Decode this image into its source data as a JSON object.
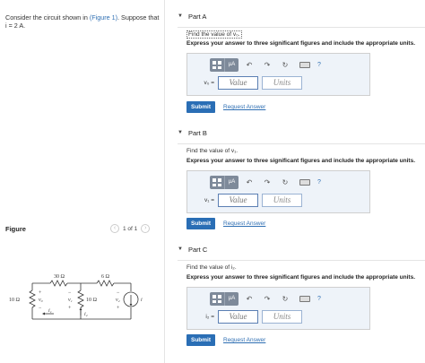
{
  "problem": {
    "text_before": "Consider the circuit shown in ",
    "figure_link": "(Figure 1)",
    "text_after": ". Suppose that i = 2 A."
  },
  "figure": {
    "label": "Figure",
    "pager_text": "1 of 1",
    "prev_icon": "chevron-left",
    "next_icon": "chevron-right",
    "circuit": {
      "r1": "10 Ω",
      "r2": "30 Ω",
      "r3": "10 Ω",
      "r4": "6 Ω",
      "v0": "v₀",
      "v1": "v₁",
      "v2": "v₂",
      "i1": "i₁",
      "i2": "i₂",
      "i": "i",
      "plus": "+",
      "minus": "−"
    }
  },
  "parts": [
    {
      "title": "Part A",
      "find": "Find the value of v₀.",
      "instruction": "Express your answer to three significant figures and include the appropriate units.",
      "var_label": "v₀ =",
      "value_placeholder": "Value",
      "units_placeholder": "Units",
      "submit": "Submit",
      "request": "Request Answer"
    },
    {
      "title": "Part B",
      "find": "Find the value of v₁.",
      "instruction": "Express your answer to three significant figures and include the appropriate units.",
      "var_label": "v₁ =",
      "value_placeholder": "Value",
      "units_placeholder": "Units",
      "submit": "Submit",
      "request": "Request Answer"
    },
    {
      "title": "Part C",
      "find": "Find the value of i₂.",
      "instruction": "Express your answer to three significant figures and include the appropriate units.",
      "var_label": "i₂ =",
      "value_placeholder": "Value",
      "units_placeholder": "Units",
      "submit": "Submit",
      "request": "Request Answer"
    }
  ],
  "toolbar": {
    "mu_label": "μA",
    "undo_icon": "undo-icon",
    "redo_icon": "redo-icon",
    "reset_icon": "reset-icon",
    "keyboard_icon": "keyboard-icon",
    "help_label": "?"
  },
  "colors": {
    "accent": "#2a6eb5",
    "link": "#2f6fb3",
    "answer_bg": "#eef3f9",
    "toolbar_btn": "#7e8a9a"
  }
}
